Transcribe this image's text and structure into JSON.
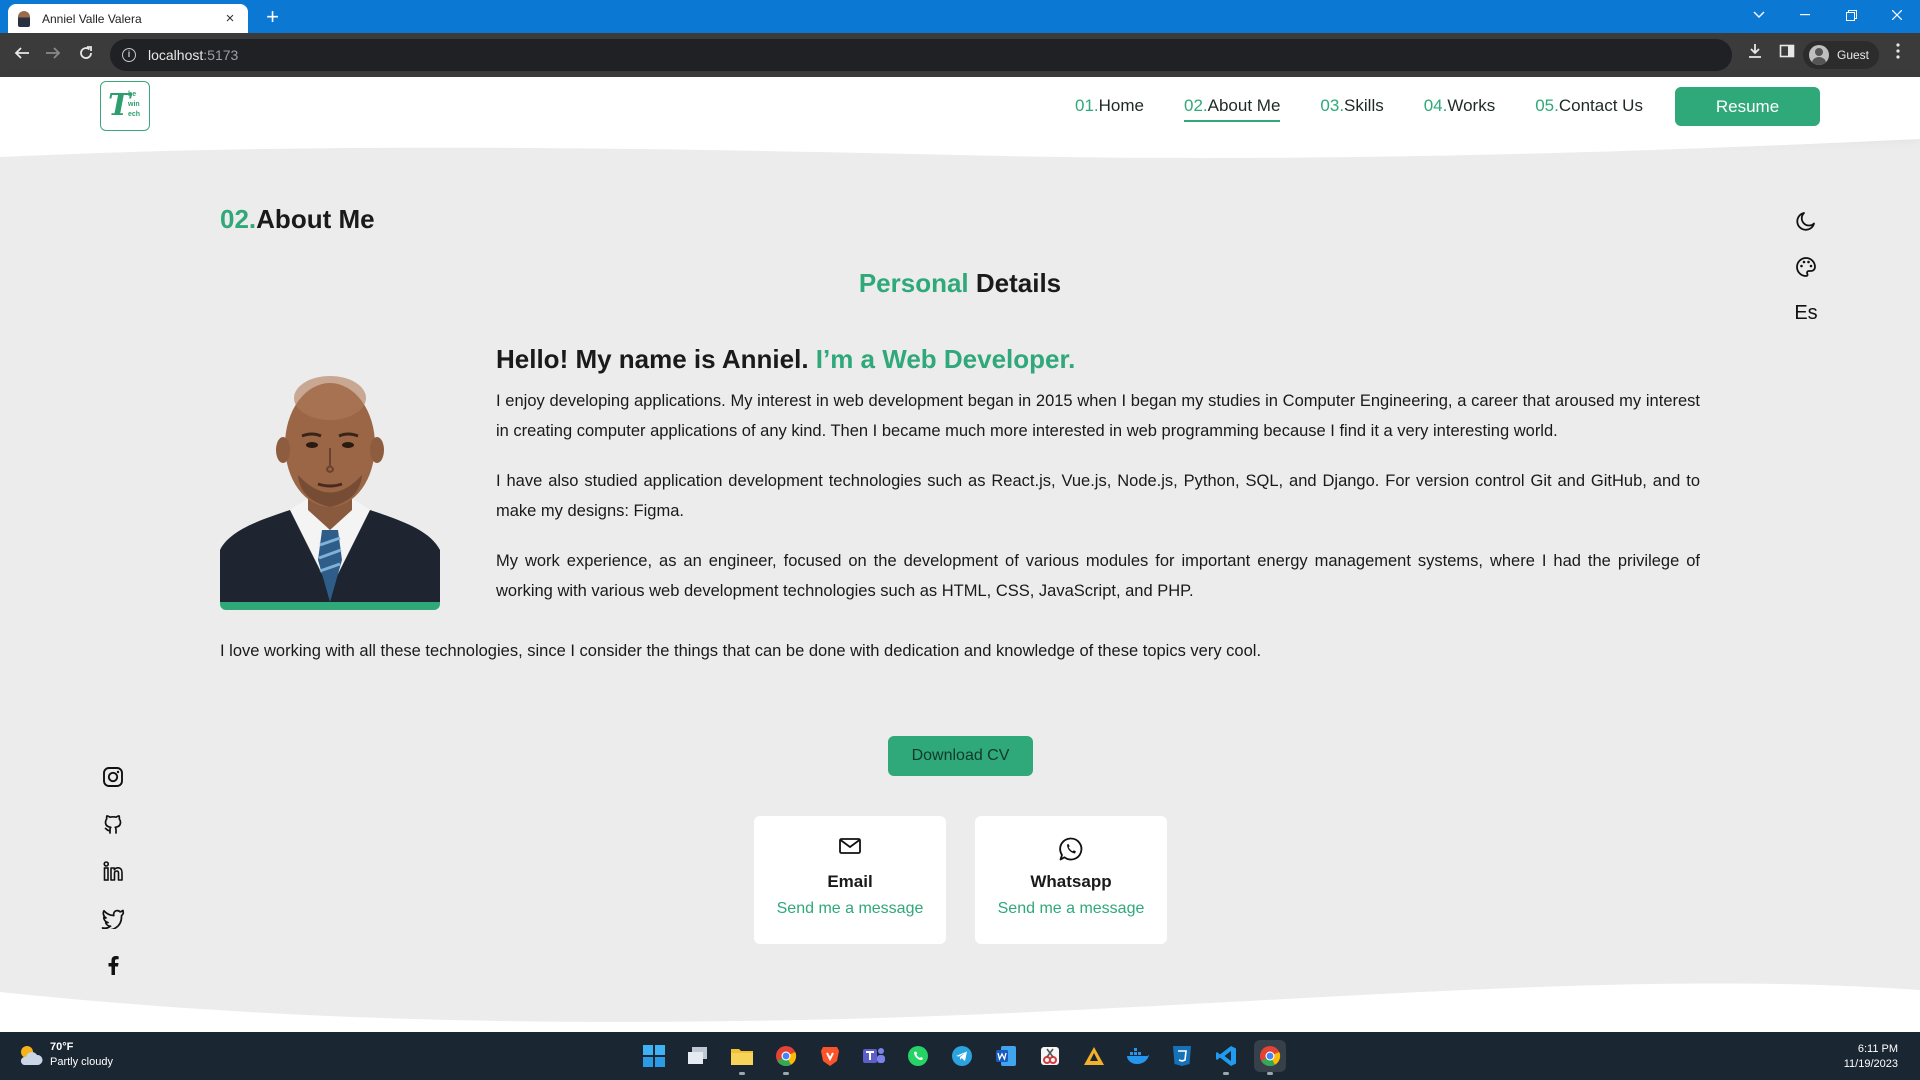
{
  "browser": {
    "tab_title": "Anniel Valle Valera",
    "tab_close": "×",
    "new_tab": "+",
    "url_host": "localhost",
    "url_port": ":5173",
    "profile_label": "Guest"
  },
  "header": {
    "logo_letter": "T",
    "logo_lines": [
      "he",
      "win",
      "ech"
    ],
    "nav": [
      {
        "num": "01.",
        "label": "Home"
      },
      {
        "num": "02.",
        "label": "About Me"
      },
      {
        "num": "03.",
        "label": "Skills"
      },
      {
        "num": "04.",
        "label": "Works"
      },
      {
        "num": "05.",
        "label": "Contact Us"
      }
    ],
    "resume_label": "Resume"
  },
  "section": {
    "num": "02.",
    "title": "About Me",
    "subtitle_accent": "Personal",
    "subtitle_rest": " Details"
  },
  "tools": {
    "language": "Es"
  },
  "about": {
    "hello": "Hello! My name is Anniel.",
    "hello_accent": " I’m a Web Developer.",
    "paragraphs": [
      "I enjoy developing applications. My interest in web development began in 2015 when I began my studies in Computer Engineering, a career that aroused my interest in creating computer applications of any kind. Then I became much more interested in web programming because I find it a very interesting world.",
      "I have also studied application development technologies such as React.js, Vue.js, Node.js, Python, SQL, and Django. For version control Git and GitHub, and to make my designs: Figma.",
      "My work experience, as an engineer, focused on the development of various modules for important energy management systems, where I had the privilege of working with various web development technologies such as HTML, CSS, JavaScript, and PHP."
    ],
    "closing": "I love working with all these technologies, since I consider the things that can be done with dedication and knowledge of these topics very cool."
  },
  "download_label": "Download CV",
  "contacts": [
    {
      "title": "Email",
      "link": "Send me a message",
      "icon": "mail-icon"
    },
    {
      "title": "Whatsapp",
      "link": "Send me a message",
      "icon": "whatsapp-icon"
    }
  ],
  "socials": [
    "instagram-icon",
    "github-icon",
    "linkedin-icon",
    "twitter-icon",
    "facebook-icon"
  ],
  "taskbar": {
    "temp": "70°F",
    "condition": "Partly cloudy",
    "time": "6:11 PM",
    "date": "11/19/2023"
  },
  "colors": {
    "accent": "#2fa87a",
    "browser_tab_bar": "#0b78d4",
    "page_bg": "#ececec",
    "taskbar": "#1b2633"
  }
}
